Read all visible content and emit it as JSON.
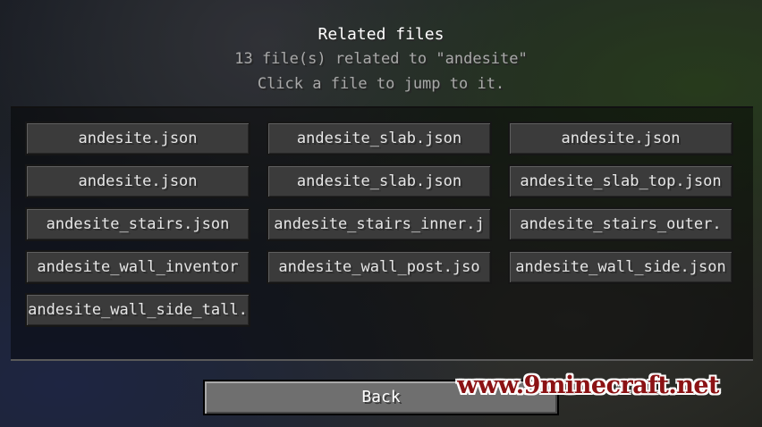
{
  "header": {
    "title": "Related files",
    "subtitle": "13 file(s) related to \"andesite\"",
    "hint": "Click a file to jump to it."
  },
  "files": [
    "andesite.json",
    "andesite_slab.json",
    "andesite.json",
    "andesite.json",
    "andesite_slab.json",
    "andesite_slab_top.json",
    "andesite_stairs.json",
    "andesite_stairs_inner.j",
    "andesite_stairs_outer.",
    "andesite_wall_inventor",
    "andesite_wall_post.jso",
    "andesite_wall_side.json",
    "andesite_wall_side_tall."
  ],
  "footer": {
    "back_label": "Back"
  },
  "watermark": "www.9minecraft.net"
}
